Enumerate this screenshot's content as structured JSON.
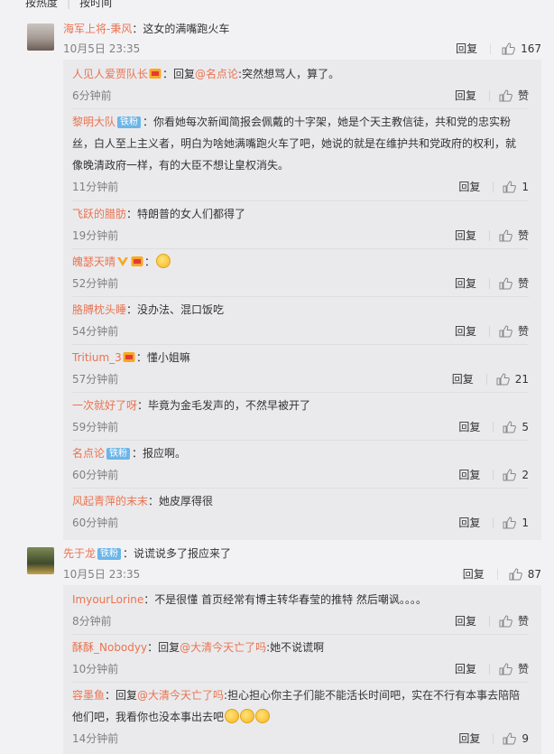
{
  "sort": {
    "hot": "按热度",
    "time": "按时间"
  },
  "colors": {
    "accent": "#eb7350",
    "badge": "#6cb5e8"
  },
  "comments": [
    {
      "user": "海军上将-秉风",
      "text": "：这女的满嘴跑火车",
      "time": "10月5日 23:35",
      "reply_label": "回复",
      "likes": "167",
      "replies": [
        {
          "user": "人见人爱贾队长",
          "text": "：回复",
          "at": "@名点论",
          "text2": ":突然想骂人，算了。",
          "time": "6分钟前",
          "reply_label": "回复",
          "likes": "赞"
        },
        {
          "user": "黎明大队",
          "badge": "铁粉",
          "text": "：你看她每次新闻简报会佩戴的十字架，她是个天主教信徒，共和党的忠实粉",
          "text_l2": "丝，白人至上主义者，明白为啥她满嘴跑火车了吧，她说的就是在维护共和党政府的权利，就",
          "text_l3": "像晚清政府一样，有的大臣不想让皇权消失。",
          "time": "11分钟前",
          "reply_label": "回复",
          "likes": "1"
        },
        {
          "user": "飞跃的腊肪",
          "text": "：特朗普的女人们都得了",
          "time": "19分钟前",
          "reply_label": "回复",
          "likes": "赞"
        },
        {
          "user": "魄瑟天晴",
          "text": "：",
          "time": "52分钟前",
          "reply_label": "回复",
          "likes": "赞"
        },
        {
          "user": "胳膊枕头睡",
          "text": "：没办法、混口饭吃",
          "time": "54分钟前",
          "reply_label": "回复",
          "likes": "赞"
        },
        {
          "user": "Tritium_3",
          "text": "：懂小姐嘛",
          "time": "57分钟前",
          "reply_label": "回复",
          "likes": "21"
        },
        {
          "user": "一次就好了呀",
          "text": "：毕竟为金毛发声的，不然早被开了",
          "time": "59分钟前",
          "reply_label": "回复",
          "likes": "5"
        },
        {
          "user": "名点论",
          "badge": "铁粉",
          "text": "：报应啊。",
          "time": "60分钟前",
          "reply_label": "回复",
          "likes": "2"
        },
        {
          "user": "风起青萍的末末",
          "text": "：她皮厚得很",
          "time": "60分钟前",
          "reply_label": "回复",
          "likes": "1"
        }
      ]
    },
    {
      "user": "先于龙",
      "badge": "铁粉",
      "text": "：说谎说多了报应来了",
      "time": "10月5日 23:35",
      "reply_label": "回复",
      "likes": "87",
      "replies": [
        {
          "user": "ImyourLorine",
          "text": "：不是很懂  首页经常有博主转华春莹的推特 然后嘲讽。。。。",
          "time": "8分钟前",
          "reply_label": "回复",
          "likes": "赞"
        },
        {
          "user": "酥酥_Nobodyy",
          "text": "：回复",
          "at": "@大清今天亡了吗",
          "text2": ":她不说谎啊",
          "time": "10分钟前",
          "reply_label": "回复",
          "likes": "赞"
        },
        {
          "user": "容墨鱼",
          "text": "：回复",
          "at": "@大清今天亡了吗",
          "text2": ":担心担心你主子们能不能活长时间吧，实在不行有本事去陪陪",
          "text_l2": "他们吧，我看你也没本事出去吧",
          "time": "14分钟前",
          "reply_label": "回复",
          "likes": "9"
        }
      ]
    }
  ]
}
